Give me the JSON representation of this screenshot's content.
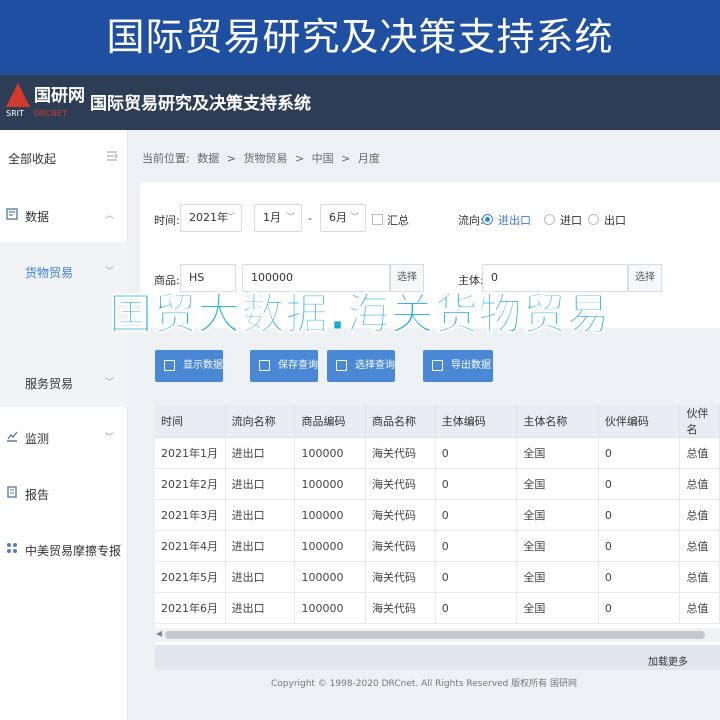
{
  "banner": {
    "title": "国际贸易研究及决策支持系统"
  },
  "header": {
    "logo_name": "国研网",
    "logo_sub1": "SRIT",
    "logo_sub2": "DRCNET",
    "title": "国际贸易研究及决策支持系统"
  },
  "sidebar": {
    "collapse_label": "全部收起",
    "items": [
      {
        "label": "数据"
      },
      {
        "label": "货物贸易"
      },
      {
        "label": "服务贸易"
      },
      {
        "label": "监测"
      },
      {
        "label": "报告"
      },
      {
        "label": "中美贸易摩擦专报"
      }
    ]
  },
  "breadcrumb": [
    "当前位置:",
    "数据",
    ">",
    "货物贸易",
    ">",
    "中国",
    ">",
    "月度"
  ],
  "filters": {
    "time_label": "时间:",
    "year": "2021年",
    "month_start": "1月",
    "dash": "-",
    "month_end": "6月",
    "summary_label": "汇总",
    "direction_label": "流向:",
    "direction_options": [
      "进出口",
      "进口",
      "出口"
    ],
    "product_label": "商品:",
    "product_type": "HS",
    "product_code": "100000",
    "select_label": "选择",
    "entity_label": "主体:",
    "entity_value": "0",
    "entity_select": "选择"
  },
  "overlay_text": "国贸大数据.海关货物贸易",
  "actions": [
    {
      "label": "显示数据",
      "color": "#4a88d6"
    },
    {
      "label": "保存查询",
      "color": "#4a88d6"
    },
    {
      "label": "选择查询",
      "color": "#4a88d6"
    },
    {
      "label": "导出数据",
      "color": "#4a88d6"
    }
  ],
  "table": {
    "headers": [
      "时间",
      "流向名称",
      "商品编码",
      "商品名称",
      "主体编码",
      "主体名称",
      "伙伴编码",
      "伙伴名"
    ],
    "rows": [
      [
        "2021年1月",
        "进出口",
        "100000",
        "海关代码",
        "0",
        "全国",
        "0",
        "总值"
      ],
      [
        "2021年2月",
        "进出口",
        "100000",
        "海关代码",
        "0",
        "全国",
        "0",
        "总值"
      ],
      [
        "2021年3月",
        "进出口",
        "100000",
        "海关代码",
        "0",
        "全国",
        "0",
        "总值"
      ],
      [
        "2021年4月",
        "进出口",
        "100000",
        "海关代码",
        "0",
        "全国",
        "0",
        "总值"
      ],
      [
        "2021年5月",
        "进出口",
        "100000",
        "海关代码",
        "0",
        "全国",
        "0",
        "总值"
      ],
      [
        "2021年6月",
        "进出口",
        "100000",
        "海关代码",
        "0",
        "全国",
        "0",
        "总值"
      ]
    ]
  },
  "load_more": "加载更多",
  "footer": "Copyright © 1998-2020 DRCnet. All Rights Reserved 版权所有 国研网"
}
